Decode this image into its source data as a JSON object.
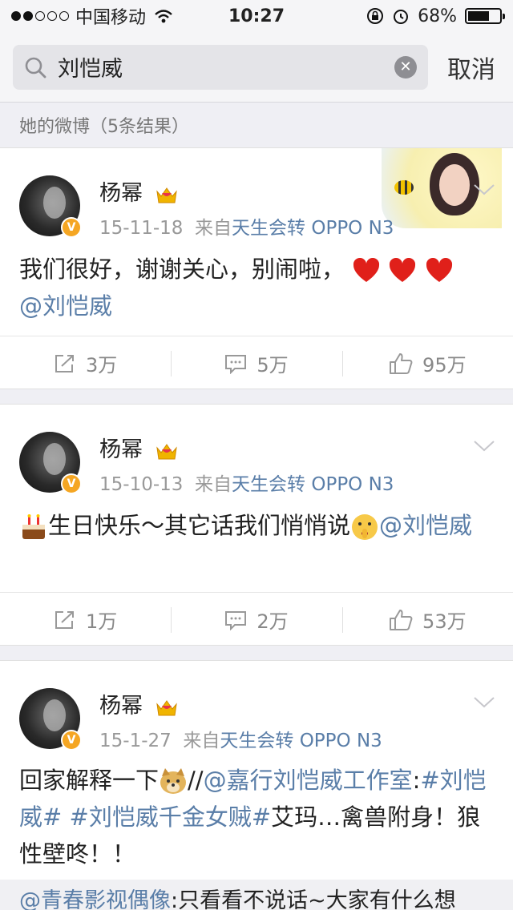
{
  "status_bar": {
    "carrier": "中国移动",
    "time": "10:27",
    "battery_percent_label": "68%",
    "battery_level": 0.68
  },
  "search": {
    "query": "刘恺威",
    "cancel_label": "取消"
  },
  "section_header": "她的微博（5条结果）",
  "posts": [
    {
      "author": "杨幂",
      "date": "15-11-18",
      "source_prefix": "来自",
      "source": "天生会转 OPPO N3",
      "text": "我们很好，谢谢关心，别闹啦，",
      "mention": "@刘恺威",
      "reposts": "3万",
      "comments": "5万",
      "likes": "95万"
    },
    {
      "author": "杨幂",
      "date": "15-10-13",
      "source_prefix": "来自",
      "source": "天生会转 OPPO N3",
      "text": "生日快乐～其它话我们悄悄说",
      "mention": "@刘恺威",
      "reposts": "1万",
      "comments": "2万",
      "likes": "53万"
    },
    {
      "author": "杨幂",
      "date": "15-1-27",
      "source_prefix": "来自",
      "source": "天生会转 OPPO N3",
      "text_1": "回家解释一下",
      "text_2": "//",
      "mention_1": "@嘉行刘恺威工作室",
      "text_3": ":",
      "topic_1": "#刘恺威#",
      "topic_2": "#刘恺威千金女贼#",
      "text_4": "艾玛…禽兽附身！狼性壁咚！！"
    }
  ],
  "repost_preview": {
    "mention": "@青春影视偶像",
    "text": ":只看看不说话~大家有什么想"
  },
  "colors": {
    "link": "#5a7ea8",
    "background": "#efeff4",
    "badge": "#f5a623"
  },
  "icons": [
    "search-icon",
    "clear-icon",
    "wifi-icon",
    "chevron-down-icon",
    "repost-icon",
    "comment-icon",
    "like-icon",
    "crown-badge-icon",
    "verified-badge-icon",
    "heart-emoji",
    "cake-emoji",
    "shush-emoji",
    "doge-emoji"
  ]
}
